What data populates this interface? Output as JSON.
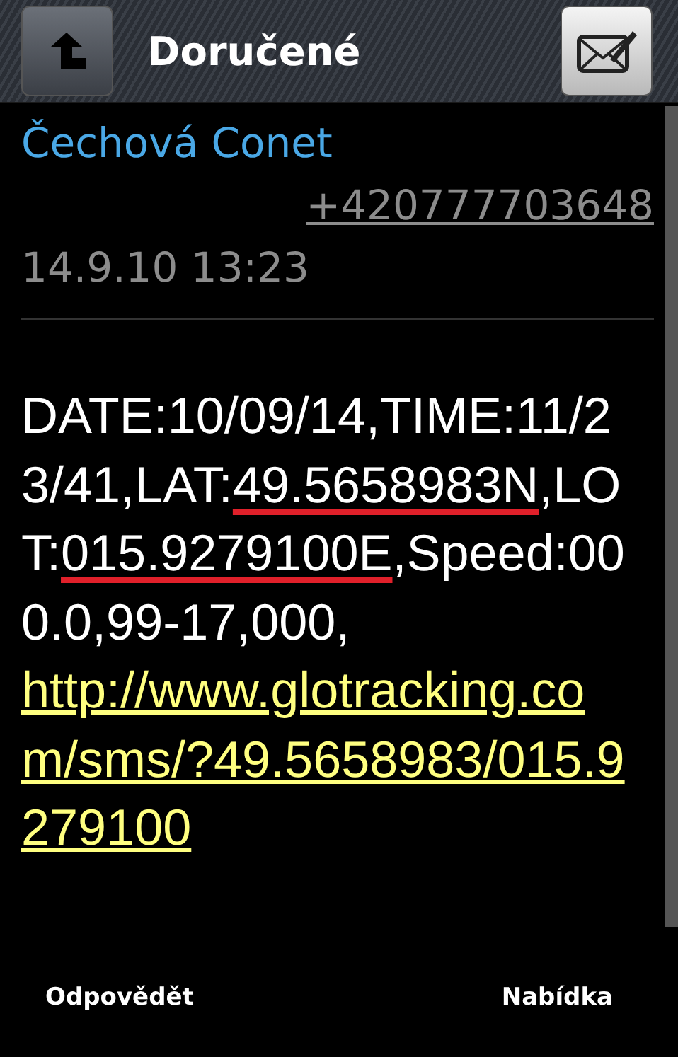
{
  "header": {
    "title": "Doručené"
  },
  "message": {
    "sender": "Čechová Conet",
    "number": "+420777703648",
    "timestamp": "14.9.10 13:23",
    "body_lines": [
      [
        {
          "text": "DATE:10/09/14,TIME:11/2",
          "marked": false
        }
      ],
      [
        {
          "text": "3/41,LAT:",
          "marked": false
        },
        {
          "text": "49.5658983N",
          "marked": true
        },
        {
          "text": ",LO",
          "marked": false
        }
      ],
      [
        {
          "text": "T:",
          "marked": false
        },
        {
          "text": "015.9279100E",
          "marked": true
        },
        {
          "text": ",Speed:00",
          "marked": false
        }
      ],
      [
        {
          "text": "0.0,99-17,000,",
          "marked": false
        }
      ]
    ],
    "link_lines": [
      "http://www.glotracking.co",
      "m/sms/?49.5658983/015.9",
      "279100"
    ]
  },
  "softkeys": [
    "Odpovědět",
    "Nabídka"
  ]
}
